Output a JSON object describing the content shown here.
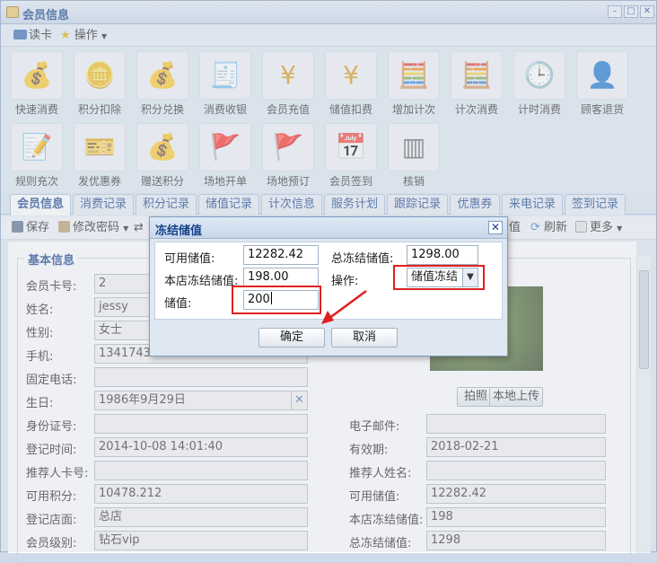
{
  "window": {
    "title": "会员信息"
  },
  "menu": {
    "read_card": "读卡",
    "operations": "操作"
  },
  "tools": [
    {
      "label": "快速消费",
      "icon": "money-bag-icon",
      "glyph": "💰"
    },
    {
      "label": "积分扣除",
      "icon": "coins-minus-icon",
      "glyph": "🪙"
    },
    {
      "label": "积分兑换",
      "icon": "coins-exchange-icon",
      "glyph": "💰"
    },
    {
      "label": "消费收银",
      "icon": "cash-register-icon",
      "glyph": "🧾"
    },
    {
      "label": "会员充值",
      "icon": "yen-plus-icon",
      "glyph": "¥"
    },
    {
      "label": "储值扣费",
      "icon": "yen-minus-icon",
      "glyph": "¥"
    },
    {
      "label": "增加计次",
      "icon": "calculator-plus-icon",
      "glyph": "🧮"
    },
    {
      "label": "计次消费",
      "icon": "calculator-icon",
      "glyph": "🧮"
    },
    {
      "label": "计时消费",
      "icon": "clock-icon",
      "glyph": "🕒"
    },
    {
      "label": "顾客退货",
      "icon": "return-user-icon",
      "glyph": "👤"
    },
    {
      "label": "规则充次",
      "icon": "edit-rule-icon",
      "glyph": "📝"
    },
    {
      "label": "发优惠券",
      "icon": "coupon-icon",
      "glyph": "🎫"
    },
    {
      "label": "赠送积分",
      "icon": "gift-points-icon",
      "glyph": "💰"
    },
    {
      "label": "场地开单",
      "icon": "venue-open-icon",
      "glyph": "🚩"
    },
    {
      "label": "场地预订",
      "icon": "venue-book-icon",
      "glyph": "🚩"
    },
    {
      "label": "会员签到",
      "icon": "calendar-icon",
      "glyph": "📅"
    },
    {
      "label": "核销",
      "icon": "barcode-icon",
      "glyph": "▥"
    }
  ],
  "tabs": [
    "会员信息",
    "消费记录",
    "积分记录",
    "储值记录",
    "计次信息",
    "服务计划",
    "跟踪记录",
    "优惠券",
    "来电记录",
    "签到记录"
  ],
  "toolbar": {
    "save": "保存",
    "change_password": "修改密码",
    "value_suffix": "值",
    "refresh": "刷新",
    "more": "更多"
  },
  "form": {
    "legend": "基本信息",
    "card_no_label": "会员卡号:",
    "card_no": "2",
    "name_label": "姓名:",
    "name": "jessy",
    "gender_label": "性别:",
    "gender": "女士",
    "phone_label": "手机:",
    "phone": "13417431",
    "landline_label": "固定电话:",
    "landline": "",
    "birthday_label": "生日:",
    "birthday": "1986年9月29日",
    "id_label": "身份证号:",
    "id": "",
    "email_label": "电子邮件:",
    "email": "",
    "reg_time_label": "登记时间:",
    "reg_time": "2014-10-08 14:01:40",
    "expiry_label": "有效期:",
    "expiry": "2018-02-21",
    "ref_card_label": "推荐人卡号:",
    "ref_card": "",
    "ref_name_label": "推荐人姓名:",
    "ref_name": "",
    "avail_points_label": "可用积分:",
    "avail_points": "10478.212",
    "avail_value_label": "可用储值:",
    "avail_value": "12282.42",
    "reg_store_label": "登记店面:",
    "reg_store": "总店",
    "store_frozen_label": "本店冻结储值:",
    "store_frozen": "198",
    "level_label": "会员级别:",
    "level": "钻石vip",
    "total_frozen_label": "总冻结储值:",
    "total_frozen": "1298",
    "photo_btn": "拍照",
    "upload_btn": "本地上传"
  },
  "dialog": {
    "title": "冻结储值",
    "avail_label": "可用储值:",
    "avail": "12282.42",
    "total_frozen_label": "总冻结储值:",
    "total_frozen": "1298.00",
    "store_frozen_label": "本店冻结储值:",
    "store_frozen": "198.00",
    "op_label": "操作:",
    "op_value": "储值冻结",
    "amount_label": "储值:",
    "amount": "200",
    "ok": "确定",
    "cancel": "取消"
  },
  "colors": {
    "highlight": "#e02020",
    "accent": "#15428b"
  }
}
